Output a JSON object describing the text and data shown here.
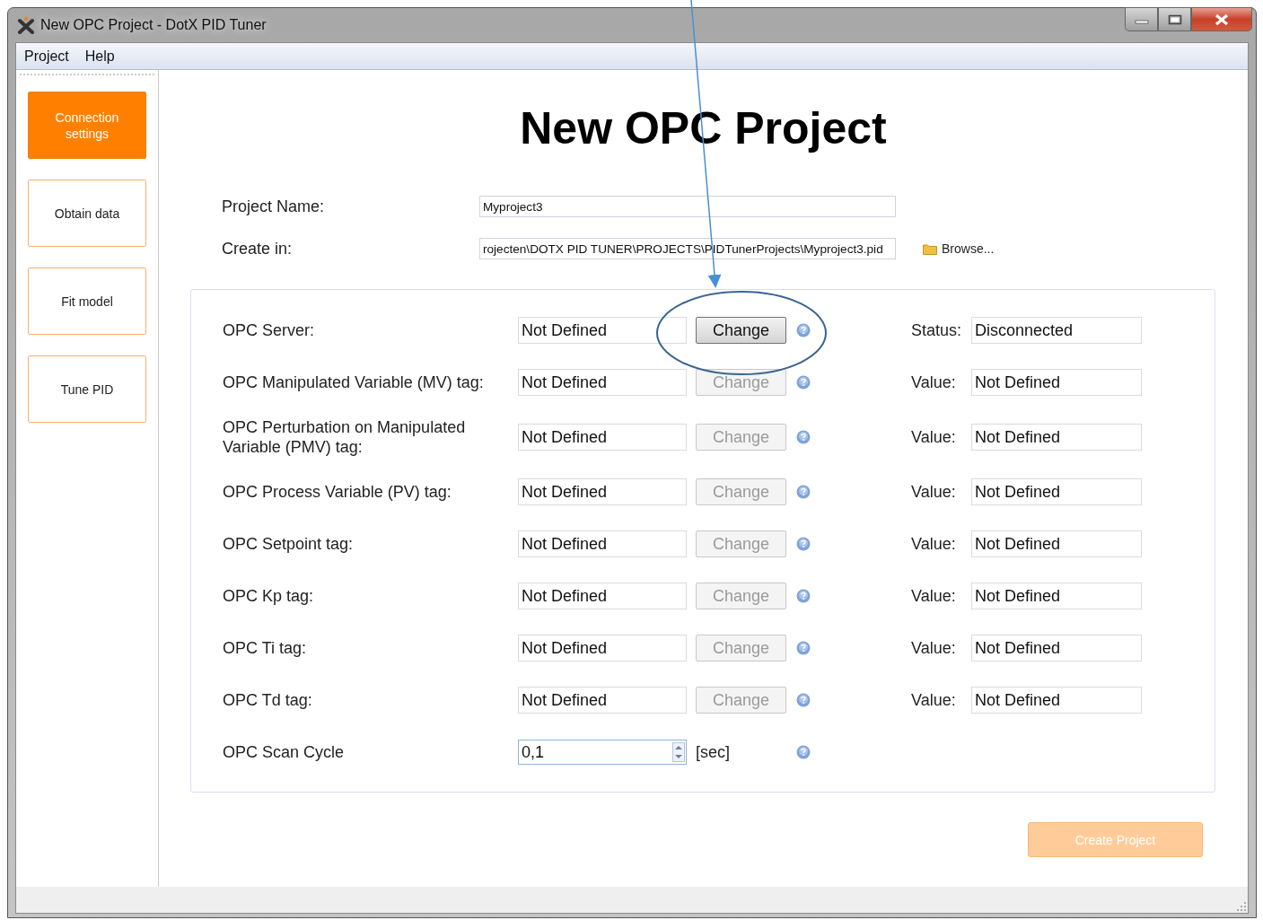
{
  "window": {
    "title": "New OPC Project - DotX PID Tuner"
  },
  "menu": [
    "Project",
    "Help"
  ],
  "sidebar": {
    "items": [
      {
        "label": "Connection settings",
        "selected": true
      },
      {
        "label": "Obtain data",
        "selected": false
      },
      {
        "label": "Fit model",
        "selected": false
      },
      {
        "label": "Tune PID",
        "selected": false
      }
    ]
  },
  "heading": "New OPC Project",
  "project_name": {
    "label": "Project Name:",
    "value": "Myproject3"
  },
  "create_in": {
    "label": "Create in:",
    "value": "rojecten\\DOTX PID TUNER\\PROJECTS\\PIDTunerProjects\\Myproject3.pid",
    "browse": "Browse..."
  },
  "opc_rows": [
    {
      "kind": "tag",
      "label": "OPC Server:",
      "value": "Not Defined",
      "button": {
        "label": "Change",
        "disabled": false
      },
      "status_label": "Status:",
      "status_value": "Disconnected"
    },
    {
      "kind": "tag",
      "label": "OPC Manipulated Variable (MV) tag:",
      "value": "Not Defined",
      "button": {
        "label": "Change",
        "disabled": true
      },
      "status_label": "Value:",
      "status_value": "Not Defined"
    },
    {
      "kind": "tag",
      "label": "OPC Perturbation on Manipulated Variable (PMV) tag:",
      "value": "Not Defined",
      "button": {
        "label": "Change",
        "disabled": true
      },
      "status_label": "Value:",
      "status_value": "Not Defined"
    },
    {
      "kind": "tag",
      "label": "OPC Process Variable (PV) tag:",
      "value": "Not Defined",
      "button": {
        "label": "Change",
        "disabled": true
      },
      "status_label": "Value:",
      "status_value": "Not Defined"
    },
    {
      "kind": "tag",
      "label": "OPC Setpoint tag:",
      "value": "Not Defined",
      "button": {
        "label": "Change",
        "disabled": true
      },
      "status_label": "Value:",
      "status_value": "Not Defined"
    },
    {
      "kind": "tag",
      "label": "OPC Kp tag:",
      "value": "Not Defined",
      "button": {
        "label": "Change",
        "disabled": true
      },
      "status_label": "Value:",
      "status_value": "Not Defined"
    },
    {
      "kind": "tag",
      "label": "OPC Ti tag:",
      "value": "Not Defined",
      "button": {
        "label": "Change",
        "disabled": true
      },
      "status_label": "Value:",
      "status_value": "Not Defined"
    },
    {
      "kind": "tag",
      "label": "OPC Td tag:",
      "value": "Not Defined",
      "button": {
        "label": "Change",
        "disabled": true
      },
      "status_label": "Value:",
      "status_value": "Not Defined"
    },
    {
      "kind": "spinner",
      "label": "OPC Scan Cycle",
      "value": "0,1",
      "unit": "[sec]"
    }
  ],
  "create_button": {
    "label": "Create Project",
    "disabled": true
  }
}
